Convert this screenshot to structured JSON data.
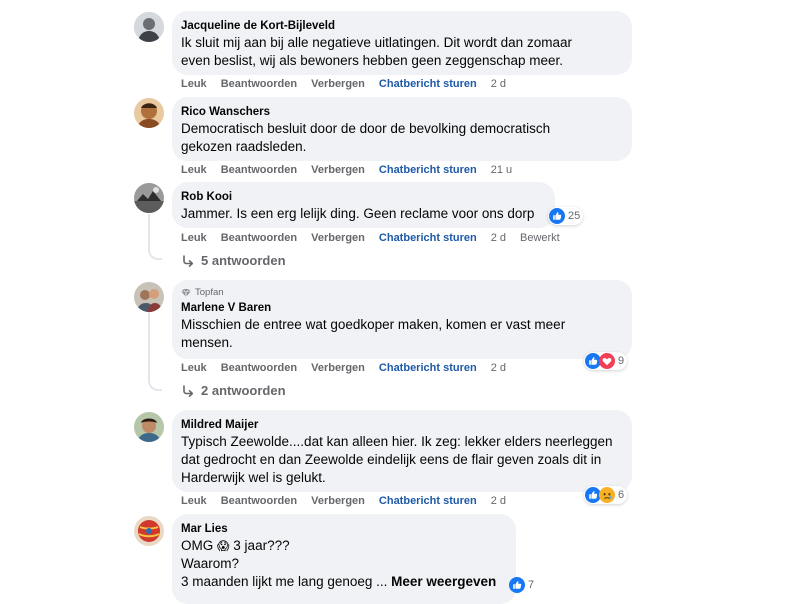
{
  "actions": {
    "like": "Leuk",
    "reply": "Beantwoorden",
    "hide": "Verbergen",
    "chat": "Chatbericht sturen",
    "edited": "Bewerkt"
  },
  "colors": {
    "bubble_bg": "#f0f2f5",
    "secondary_text": "#65676b",
    "chat_link": "#1e5aa8",
    "like_blue": "#1877f2",
    "love_red": "#f33e58",
    "sad_yellow": "#f7b125"
  },
  "comments": [
    {
      "author": "Jacqueline de Kort-Bijleveld",
      "lines": [
        "Ik sluit mij aan bij alle negatieve uitlatingen. Dit wordt dan zomaar",
        "even beslist, wij als bewoners hebben geen zeggenschap meer."
      ],
      "time": "2 d"
    },
    {
      "author": "Rico Wanschers",
      "lines": [
        "Democratisch besluit door de door de bevolking democratisch",
        "gekozen raadsleden."
      ],
      "time": "21 u"
    },
    {
      "author": "Rob Kooi",
      "lines": [
        "Jammer. Is een erg lelijk ding. Geen reclame voor ons dorp"
      ],
      "time": "2 d",
      "reaction_count": "25",
      "reaction_icons": [
        "like-icon"
      ],
      "replies": "5 antwoorden"
    },
    {
      "badge": "Topfan",
      "author": "Marlene V Baren",
      "lines": [
        "Misschien de entree wat goedkoper maken, komen er vast meer",
        "mensen."
      ],
      "time": "2 d",
      "reaction_count": "9",
      "reaction_icons": [
        "like-icon",
        "love-icon"
      ],
      "replies": "2 antwoorden"
    },
    {
      "author": "Mildred Maijer",
      "lines": [
        "Typisch Zeewolde....dat kan alleen hier. Ik zeg: lekker elders neerleggen",
        "dat gedrocht en dan Zeewolde eindelijk eens de flair geven zoals dit in",
        "Harderwijk wel is gelukt."
      ],
      "time": "2 d",
      "reaction_count": "6",
      "reaction_icons": [
        "like-icon",
        "sad-icon"
      ]
    },
    {
      "author": "Mar Lies",
      "lines": [
        "OMG",
        "3 jaar???",
        "Waarom?",
        "3 maanden lijkt me lang genoeg ..."
      ],
      "emoji": "😱",
      "see_more": "Meer weergeven",
      "reaction_count": "7",
      "reaction_icons": [
        "like-icon"
      ]
    }
  ]
}
